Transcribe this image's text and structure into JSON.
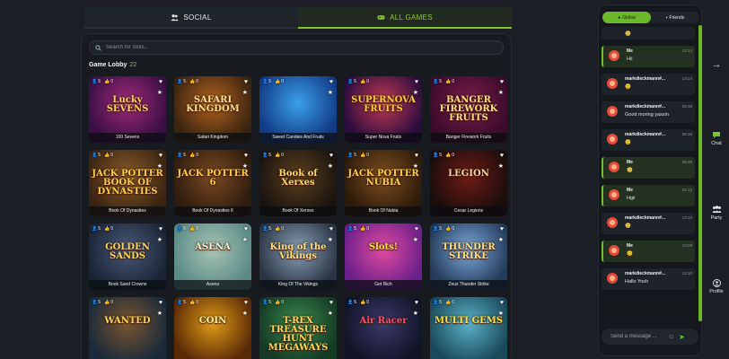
{
  "tabs": {
    "social": "SOCIAL",
    "all_games": "ALL GAMES"
  },
  "search": {
    "placeholder": "Search for Slots..."
  },
  "lobby": {
    "title": "Game Lobby",
    "count": "22"
  },
  "games": [
    {
      "name": "100 Sevens",
      "players": "5",
      "favs": "0",
      "art": "Lucky SEVENS",
      "bg": [
        "#3a0f45",
        "#a02a7a"
      ],
      "fg": "#ffd45a"
    },
    {
      "name": "Safari Kingdom",
      "players": "5",
      "favs": "0",
      "art": "SAFARI KINGDOM",
      "bg": [
        "#3a2410",
        "#b3621e"
      ],
      "fg": "#ffe08a"
    },
    {
      "name": "Sweet Candies And Fruits",
      "players": "5",
      "favs": "0",
      "art": "",
      "bg": [
        "#123b86",
        "#3aa0e8"
      ],
      "fg": "#ffffff"
    },
    {
      "name": "Super Nova Fruits",
      "players": "5",
      "favs": "0",
      "art": "SUPERNOVA FRUITS",
      "bg": [
        "#2a0c3e",
        "#c43a52"
      ],
      "fg": "#ffcf3a"
    },
    {
      "name": "Banger Firework Fruits",
      "players": "5",
      "favs": "0",
      "art": "BANGER FIREWORK FRUITS",
      "bg": [
        "#3b0b2a",
        "#7a1d4a"
      ],
      "fg": "#ffe07a"
    },
    {
      "name": "Book Of Dynasties",
      "players": "5",
      "favs": "0",
      "art": "JACK POTTER BOOK OF DYNASTIES",
      "bg": [
        "#3a2412",
        "#8a5a2a"
      ],
      "fg": "#ffcc44"
    },
    {
      "name": "Book Of Dynasties 6",
      "players": "5",
      "favs": "0",
      "art": "JACK POTTER 6",
      "bg": [
        "#2e1c0f",
        "#7a4a22"
      ],
      "fg": "#ffcc44"
    },
    {
      "name": "Book Of Xerxes",
      "players": "5",
      "favs": "0",
      "art": "Book of Xerxes",
      "bg": [
        "#1a1410",
        "#5c3f1c"
      ],
      "fg": "#ffd76a"
    },
    {
      "name": "Book Of Nubia",
      "players": "5",
      "favs": "0",
      "art": "JACK POTTER NUBIA",
      "bg": [
        "#2c1a0a",
        "#7e5020"
      ],
      "fg": "#ffcc44"
    },
    {
      "name": "Cesar Legions",
      "players": "5",
      "favs": "0",
      "art": "LEGION",
      "bg": [
        "#1a0d0d",
        "#6e1b15"
      ],
      "fg": "#f0d7a0"
    },
    {
      "name": "Book Sand Crowns",
      "players": "5",
      "favs": "0",
      "art": "GOLDEN SANDS",
      "bg": [
        "#1a2436",
        "#4a5a7a"
      ],
      "fg": "#ffd45a"
    },
    {
      "name": "Asena",
      "players": "5",
      "favs": "0",
      "art": "ASENA",
      "bg": [
        "#5a8a86",
        "#a8c4b4"
      ],
      "fg": "#f6f2d6"
    },
    {
      "name": "King Of The Vikings",
      "players": "5",
      "favs": "0",
      "art": "King of the Vikings",
      "bg": [
        "#2a3444",
        "#8aa0b8"
      ],
      "fg": "#ffe07a"
    },
    {
      "name": "Get Rich",
      "players": "5",
      "favs": "0",
      "art": "Slots!",
      "bg": [
        "#6a1f8a",
        "#e04aa0"
      ],
      "fg": "#ffe23a"
    },
    {
      "name": "Zeus Thunder Strike",
      "players": "5",
      "favs": "0",
      "art": "THUNDER STRIKE",
      "bg": [
        "#243a5a",
        "#7aa8d8"
      ],
      "fg": "#ffe07a"
    },
    {
      "name": "",
      "players": "5",
      "favs": "0",
      "art": "WANTED",
      "bg": [
        "#1a2a3a",
        "#7a5530"
      ],
      "fg": "#ffd45a"
    },
    {
      "name": "",
      "players": "5",
      "favs": "0",
      "art": "COIN",
      "bg": [
        "#5a2a06",
        "#e09a18"
      ],
      "fg": "#fff1a0"
    },
    {
      "name": "",
      "players": "5",
      "favs": "0",
      "art": "T-REX TREASURE HUNT MEGAWAYS",
      "bg": [
        "#143a26",
        "#3a8a4a"
      ],
      "fg": "#ffd45a"
    },
    {
      "name": "",
      "players": "5",
      "favs": "0",
      "art": "Air Racer",
      "bg": [
        "#101426",
        "#3a3a6a"
      ],
      "fg": "#ff4a6a"
    },
    {
      "name": "",
      "players": "5",
      "favs": "0",
      "art": "MULTI GEMS",
      "bg": [
        "#1a4a5a",
        "#5ab0c8"
      ],
      "fg": "#ffe23a"
    }
  ],
  "chat": {
    "tab_global": "Global",
    "tab_friends": "Friends",
    "messages": [
      {
        "user": "",
        "time": "",
        "text": "😊",
        "self": false,
        "partial": true
      },
      {
        "user": "Me",
        "time": "13:14",
        "text": "Hii",
        "self": true
      },
      {
        "user": "markdieckmann#...",
        "time": "13:14",
        "text": "😊",
        "self": false
      },
      {
        "user": "markdieckmann#...",
        "time": "08:38",
        "text": "Good moring yassin",
        "self": false
      },
      {
        "user": "markdieckmann#...",
        "time": "08:38",
        "text": "😊",
        "self": false
      },
      {
        "user": "Me",
        "time": "08:39",
        "text": "😊",
        "self": true
      },
      {
        "user": "Me",
        "time": "04:12",
        "text": "Hgii",
        "self": true
      },
      {
        "user": "markdieckmann#...",
        "time": "13:10",
        "text": "😊",
        "self": false
      },
      {
        "user": "Me",
        "time": "13:09",
        "text": "😊",
        "self": true
      },
      {
        "user": "markdieckmann#...",
        "time": "13:10",
        "text": "Hallo Yosh",
        "self": false
      }
    ],
    "composer_placeholder": "Send a message ..."
  },
  "rail": {
    "chat": "Chat",
    "party": "Party",
    "profile": "Profile"
  },
  "colors": {
    "accent": "#7fc42a",
    "panel": "#171b20",
    "bg": "#1b1f25"
  }
}
